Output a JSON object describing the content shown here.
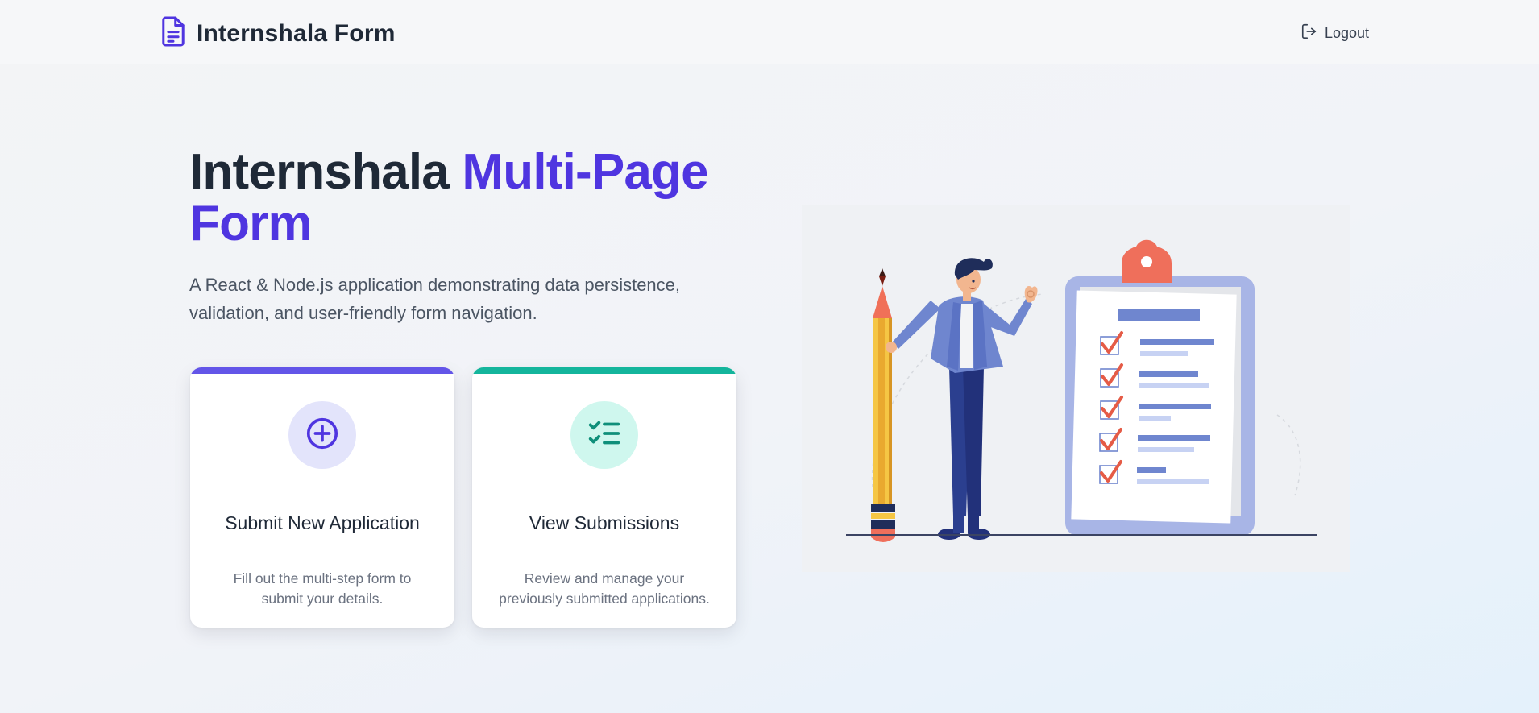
{
  "header": {
    "brand_icon": "document-text-icon",
    "brand_title": "Internshala Form",
    "logout_icon": "logout-icon",
    "logout_label": "Logout"
  },
  "hero": {
    "title_part1": "Internshala ",
    "title_part2": "Multi-Page Form",
    "subtitle": "A React & Node.js application demonstrating data persistence, validation, and user-friendly form navigation."
  },
  "cards": [
    {
      "icon": "plus-circle-icon",
      "title": "Submit New Application",
      "description": "Fill out the multi-step form to submit your details.",
      "accent_color": "#6355e8",
      "icon_bg": "#e3e4fb"
    },
    {
      "icon": "list-checks-icon",
      "title": "View Submissions",
      "description": "Review and manage your previously submitted applications.",
      "accent_color": "#14b59c",
      "icon_bg": "#cff7ee"
    }
  ],
  "colors": {
    "brand": "#4f35e0",
    "heading": "#1f2937",
    "body_text": "#4b5563"
  },
  "illustration": {
    "name": "person-with-pencil-and-checklist-clipboard"
  }
}
